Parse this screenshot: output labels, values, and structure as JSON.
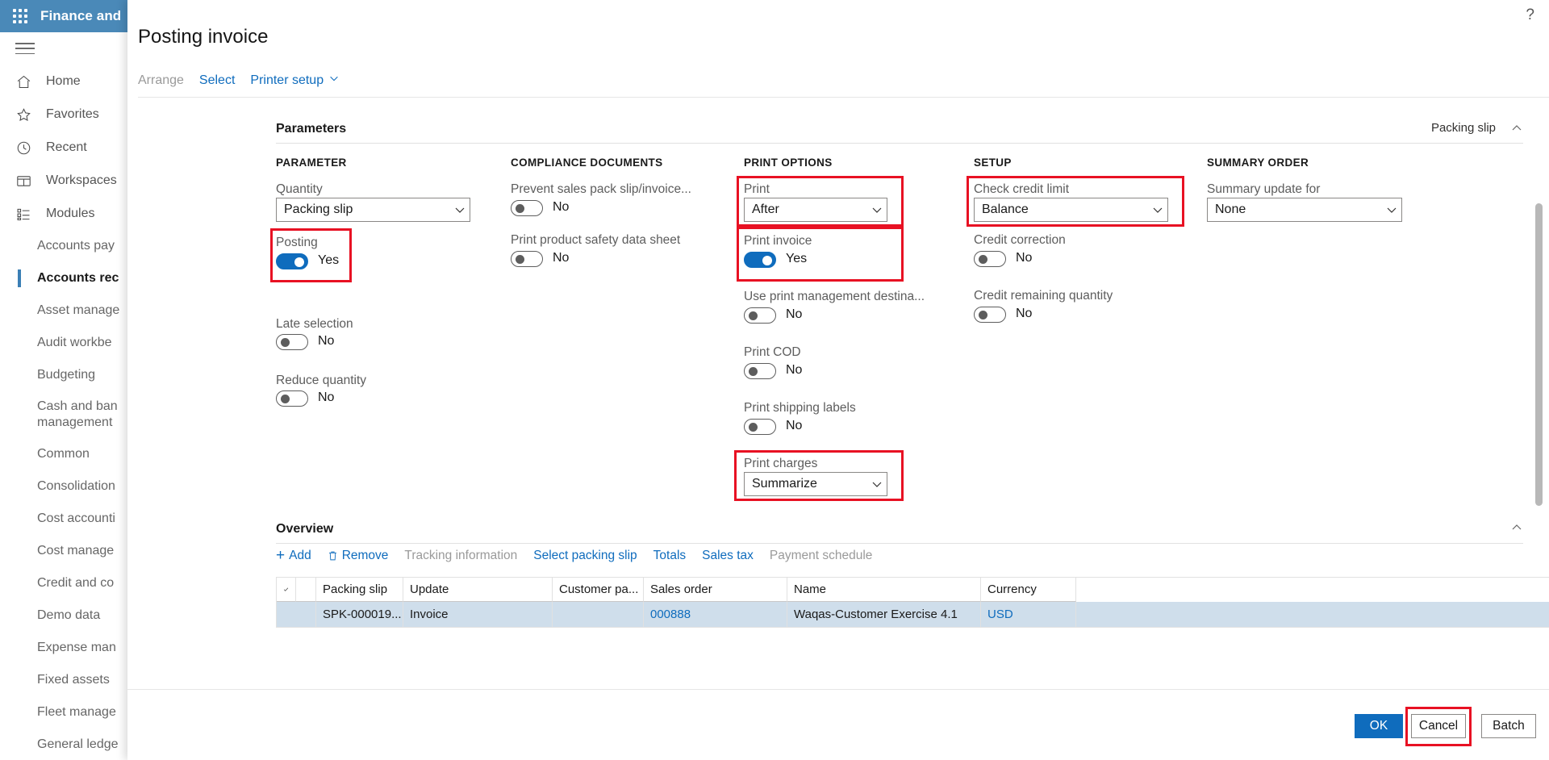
{
  "app": {
    "title": "Finance and",
    "waffle_icon": "app-launcher-icon",
    "help_icon": "help-question-icon"
  },
  "nav": {
    "hamburger_icon": "hamburger-icon",
    "primary": [
      {
        "label": "Home",
        "icon": "home-icon"
      },
      {
        "label": "Favorites",
        "icon": "star-icon"
      },
      {
        "label": "Recent",
        "icon": "clock-icon"
      },
      {
        "label": "Workspaces",
        "icon": "workspace-icon"
      },
      {
        "label": "Modules",
        "icon": "modules-icon"
      }
    ],
    "modules": [
      {
        "label": "Accounts pay",
        "selected": false
      },
      {
        "label": "Accounts rec",
        "selected": true
      },
      {
        "label": "Asset manage",
        "selected": false
      },
      {
        "label": "Audit workbe",
        "selected": false
      },
      {
        "label": "Budgeting",
        "selected": false
      },
      {
        "label": "Cash and ban\nmanagement",
        "selected": false,
        "two_line": true
      },
      {
        "label": "Common",
        "selected": false
      },
      {
        "label": "Consolidation",
        "selected": false
      },
      {
        "label": "Cost accounti",
        "selected": false
      },
      {
        "label": "Cost manage",
        "selected": false
      },
      {
        "label": "Credit and co",
        "selected": false
      },
      {
        "label": "Demo data",
        "selected": false
      },
      {
        "label": "Expense man",
        "selected": false
      },
      {
        "label": "Fixed assets",
        "selected": false
      },
      {
        "label": "Fleet manage",
        "selected": false
      },
      {
        "label": "General ledge",
        "selected": false
      }
    ]
  },
  "dialog": {
    "title": "Posting invoice",
    "toolbar": {
      "arrange": "Arrange",
      "select": "Select",
      "printer_setup": "Printer setup",
      "printer_setup_caret_icon": "chevron-down-icon"
    }
  },
  "parameters": {
    "section_title": "Parameters",
    "right_label": "Packing slip",
    "collapse_icon": "chevron-up-icon",
    "columns": {
      "parameter": "PARAMETER",
      "compliance": "COMPLIANCE DOCUMENTS",
      "print_options": "PRINT OPTIONS",
      "setup": "SETUP",
      "summary_order": "SUMMARY ORDER"
    },
    "fields": {
      "quantity": {
        "label": "Quantity",
        "value": "Packing slip"
      },
      "posting": {
        "label": "Posting",
        "value": "Yes",
        "on": true
      },
      "late_selection": {
        "label": "Late selection",
        "value": "No",
        "on": false
      },
      "reduce_quantity": {
        "label": "Reduce quantity",
        "value": "No",
        "on": false
      },
      "prevent_sales_pack": {
        "label": "Prevent sales pack slip/invoice...",
        "value": "No",
        "on": false
      },
      "print_product_safety": {
        "label": "Print product safety data sheet",
        "value": "No",
        "on": false
      },
      "print": {
        "label": "Print",
        "value": "After"
      },
      "print_invoice": {
        "label": "Print invoice",
        "value": "Yes",
        "on": true
      },
      "use_print_mgmt": {
        "label": "Use print management destina...",
        "value": "No",
        "on": false
      },
      "print_cod": {
        "label": "Print COD",
        "value": "No",
        "on": false
      },
      "print_shipping_labels": {
        "label": "Print shipping labels",
        "value": "No",
        "on": false
      },
      "print_charges": {
        "label": "Print charges",
        "value": "Summarize"
      },
      "check_credit_limit": {
        "label": "Check credit limit",
        "value": "Balance"
      },
      "credit_correction": {
        "label": "Credit correction",
        "value": "No",
        "on": false
      },
      "credit_remaining_quantity": {
        "label": "Credit remaining quantity",
        "value": "No",
        "on": false
      },
      "summary_update_for": {
        "label": "Summary update for",
        "value": "None"
      }
    },
    "highlight_color": "#e81123"
  },
  "overview": {
    "section_title": "Overview",
    "collapse_icon": "chevron-up-icon",
    "actions": [
      {
        "label": "Add",
        "icon": "plus-icon",
        "disabled": false
      },
      {
        "label": "Remove",
        "icon": "trash-icon",
        "disabled": false
      },
      {
        "label": "Tracking information",
        "disabled": true
      },
      {
        "label": "Select packing slip",
        "disabled": false
      },
      {
        "label": "Totals",
        "disabled": false
      },
      {
        "label": "Sales tax",
        "disabled": false
      },
      {
        "label": "Payment schedule",
        "disabled": true
      }
    ],
    "grid": {
      "select_all_icon": "checkmark-icon",
      "headers": [
        "Packing slip",
        "Update",
        "Customer pa...",
        "Sales order",
        "Name",
        "Currency"
      ],
      "rows": [
        {
          "packing_slip": "SPK-000019...",
          "update": "Invoice",
          "customer_pa": "",
          "sales_order": "000888",
          "name": "Waqas-Customer Exercise 4.1",
          "currency": "USD"
        }
      ]
    }
  },
  "footer": {
    "ok": "OK",
    "cancel": "Cancel",
    "batch": "Batch"
  }
}
